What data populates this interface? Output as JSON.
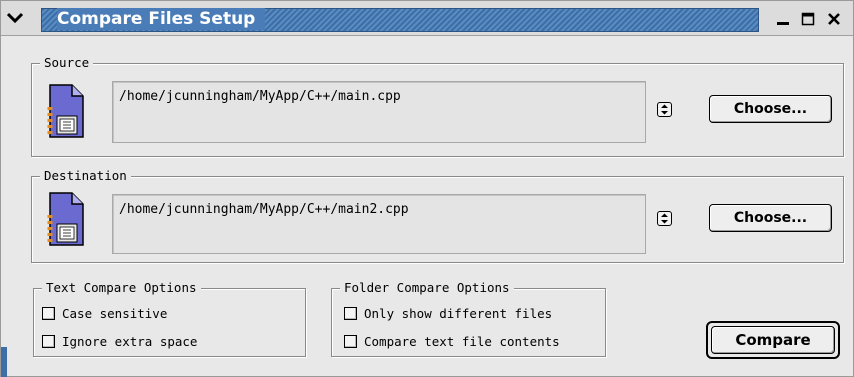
{
  "window": {
    "title": "Compare Files Setup",
    "controls": {
      "menu_icon": "chevron-down-icon",
      "minimize_icon": "minimize-icon",
      "maximize_icon": "maximize-icon",
      "close_icon": "close-icon"
    }
  },
  "source": {
    "label": "Source",
    "path": "/home/jcunningham/MyApp/C++/main.cpp",
    "icon": "document-icon",
    "choose_label": "Choose..."
  },
  "destination": {
    "label": "Destination",
    "path": "/home/jcunningham/MyApp/C++/main2.cpp",
    "icon": "document-icon",
    "choose_label": "Choose..."
  },
  "text_options": {
    "label": "Text Compare Options",
    "items": [
      {
        "label": "Case sensitive",
        "checked": false
      },
      {
        "label": "Ignore extra space",
        "checked": false
      }
    ]
  },
  "folder_options": {
    "label": "Folder Compare Options",
    "items": [
      {
        "label": "Only show different files",
        "checked": false
      },
      {
        "label": "Compare text file contents",
        "checked": false
      }
    ]
  },
  "compare_label": "Compare",
  "colors": {
    "title_bar": "#4a7db8",
    "window_bg": "#e8e8e8"
  }
}
